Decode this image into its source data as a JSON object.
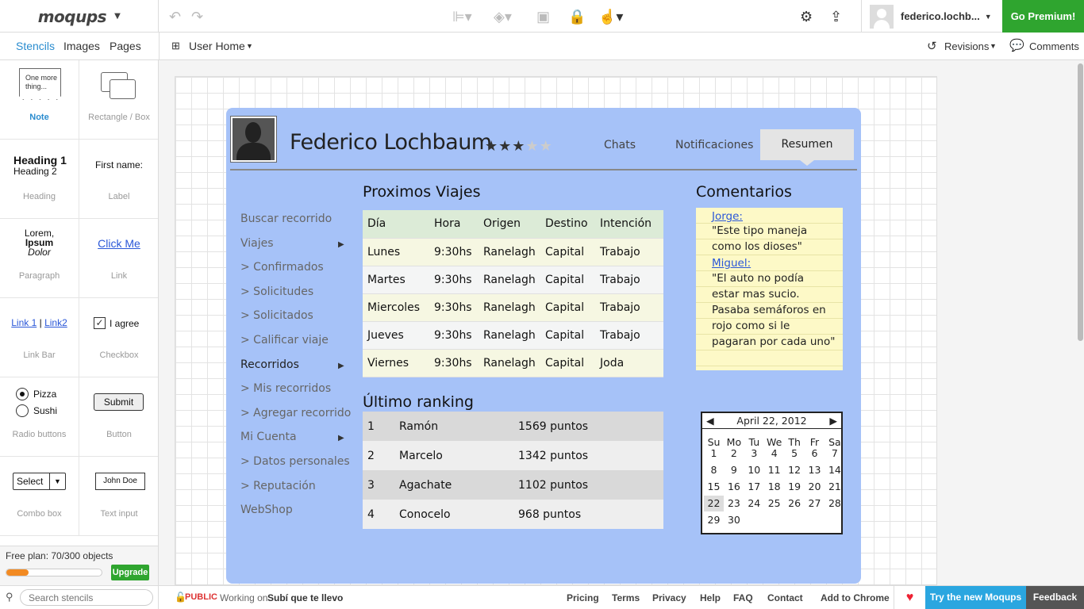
{
  "app": {
    "logo": "moqups",
    "user": "federico.lochb...",
    "premium_button": "Go Premium!"
  },
  "subbar": {
    "tabs": [
      "Stencils",
      "Images",
      "Pages"
    ],
    "page_selector": "User Home",
    "revisions": "Revisions",
    "comments": "Comments"
  },
  "stencils": [
    {
      "caption": "Note",
      "preview": "One more thing..."
    },
    {
      "caption": "Rectangle / Box"
    },
    {
      "caption": "Heading",
      "h1": "Heading 1",
      "h2": "Heading 2"
    },
    {
      "caption": "Label",
      "preview": "First name:"
    },
    {
      "caption": "Paragraph",
      "l1": "Lorem,",
      "l2": "Ipsum",
      "l3": "Dolor"
    },
    {
      "caption": "Link",
      "preview": "Click Me"
    },
    {
      "caption": "Link Bar",
      "l1": "Link 1",
      "sep": "|",
      "l2": "Link2"
    },
    {
      "caption": "Checkbox",
      "preview": "I agree"
    },
    {
      "caption": "Radio buttons",
      "o1": "Pizza",
      "o2": "Sushi"
    },
    {
      "caption": "Button",
      "preview": "Submit"
    },
    {
      "caption": "Combo box",
      "preview": "Select"
    },
    {
      "caption": "Text input",
      "preview": "John Doe"
    }
  ],
  "plan": {
    "text": "Free plan: 70/300 objects",
    "upgrade": "Upgrade",
    "fill": 0.23
  },
  "search": {
    "placeholder": "Search stencils"
  },
  "mockup": {
    "name": "Federico Lochbaum",
    "stars_filled": 3,
    "stars_total": 5,
    "tabs": [
      "Chats",
      "Notificaciones",
      "Resumen"
    ],
    "nav": [
      {
        "label": "Buscar recorrido",
        "dark": false,
        "arrow": false
      },
      {
        "label": "Viajes",
        "dark": false,
        "arrow": true
      },
      {
        "label": "> Confirmados",
        "dark": false,
        "arrow": false
      },
      {
        "label": "> Solicitudes",
        "dark": false,
        "arrow": false
      },
      {
        "label": "> Solicitados",
        "dark": false,
        "arrow": false
      },
      {
        "label": "> Calificar viaje",
        "dark": false,
        "arrow": false
      },
      {
        "label": "Recorridos",
        "dark": true,
        "arrow": true
      },
      {
        "label": "> Mis recorridos",
        "dark": false,
        "arrow": false
      },
      {
        "label": "> Agregar recorrido",
        "dark": false,
        "arrow": false
      },
      {
        "label": "Mi Cuenta",
        "dark": false,
        "arrow": true
      },
      {
        "label": "> Datos personales",
        "dark": false,
        "arrow": false
      },
      {
        "label": "> Reputación",
        "dark": false,
        "arrow": false
      },
      {
        "label": "WebShop",
        "dark": false,
        "arrow": false
      }
    ],
    "trips_title": "Proximos Viajes",
    "trips_header": [
      "Día",
      "Hora",
      "Origen",
      "Destino",
      "Intención"
    ],
    "trips": [
      [
        "Lunes",
        "9:30hs",
        "Ranelagh",
        "Capital",
        "Trabajo"
      ],
      [
        "Martes",
        "9:30hs",
        "Ranelagh",
        "Capital",
        "Trabajo"
      ],
      [
        "Miercoles",
        "9:30hs",
        "Ranelagh",
        "Capital",
        "Trabajo"
      ],
      [
        "Jueves",
        "9:30hs",
        "Ranelagh",
        "Capital",
        "Trabajo"
      ],
      [
        "Viernes",
        "9:30hs",
        "Ranelagh",
        "Capital",
        "Joda"
      ]
    ],
    "ranking_title": "Último ranking",
    "ranking": [
      [
        "1",
        "Ramón",
        "1569 puntos"
      ],
      [
        "2",
        "Marcelo",
        "1342 puntos"
      ],
      [
        "3",
        "Agachate",
        "1102 puntos"
      ],
      [
        "4",
        "Conocelo",
        "968 puntos"
      ]
    ],
    "comments_title": "Comentarios",
    "comments": [
      {
        "text": "Jorge:",
        "link": true
      },
      {
        "text": "\"Este tipo maneja",
        "link": false
      },
      {
        "text": "como los dioses\"",
        "link": false
      },
      {
        "text": "Miguel:",
        "link": true
      },
      {
        "text": "\"El auto no podía",
        "link": false
      },
      {
        "text": "estar mas sucio.",
        "link": false
      },
      {
        "text": "Pasaba semáforos en",
        "link": false
      },
      {
        "text": "rojo como si le",
        "link": false
      },
      {
        "text": "pagaran por cada uno\"",
        "link": false
      }
    ],
    "calendar": {
      "title": "April 22, 2012",
      "weekdays": [
        "Su",
        "Mo",
        "Tu",
        "We",
        "Th",
        "Fr",
        "Sa"
      ],
      "days": [
        "1",
        "2",
        "3",
        "4",
        "5",
        "6",
        "7",
        "8",
        "9",
        "10",
        "11",
        "12",
        "13",
        "14",
        "15",
        "16",
        "17",
        "18",
        "19",
        "20",
        "21",
        "22",
        "23",
        "24",
        "25",
        "26",
        "27",
        "28",
        "29",
        "30"
      ],
      "selected": "22"
    }
  },
  "footer": {
    "public": "PUBLIC",
    "working_on": "Working on",
    "project": "Subí que te llevo",
    "links": [
      "Pricing",
      "Terms",
      "Privacy",
      "Help",
      "FAQ",
      "Contact",
      "Add to Chrome"
    ],
    "try_new": "Try the new Moqups",
    "feedback": "Feedback"
  },
  "colors": {
    "accent": "#2a8ccf",
    "premium": "#2fa52f",
    "mock_bg": "#a6c2f8",
    "footer_try": "#2aa6e0"
  }
}
